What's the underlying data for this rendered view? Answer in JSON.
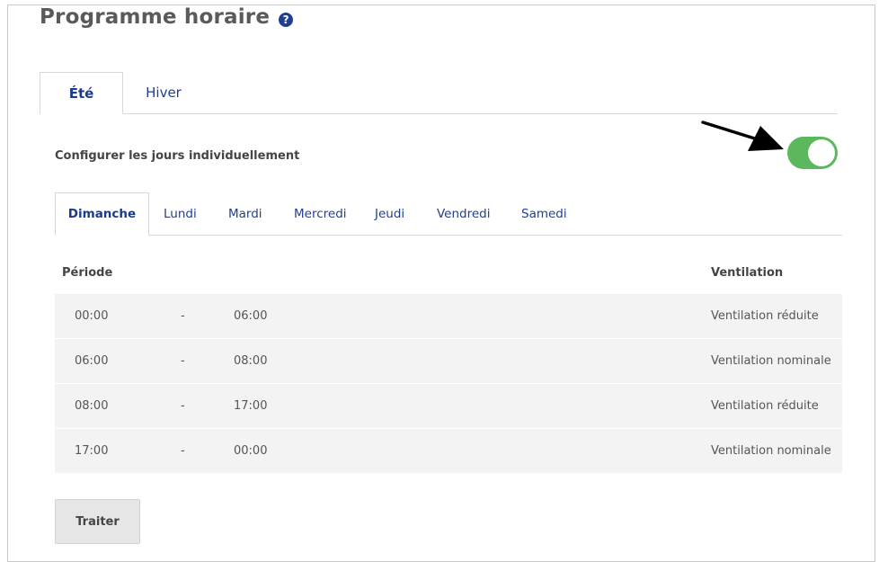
{
  "page": {
    "title": "Programme horaire",
    "help_glyph": "?"
  },
  "season_tabs": [
    {
      "label": "Été",
      "active": true
    },
    {
      "label": "Hiver",
      "active": false
    }
  ],
  "config": {
    "label": "Configurer les jours individuellement",
    "toggle_on": true
  },
  "day_tabs": [
    {
      "label": "Dimanche",
      "active": true
    },
    {
      "label": "Lundi",
      "active": false
    },
    {
      "label": "Mardi",
      "active": false
    },
    {
      "label": "Mercredi",
      "active": false
    },
    {
      "label": "Jeudi",
      "active": false
    },
    {
      "label": "Vendredi",
      "active": false
    },
    {
      "label": "Samedi",
      "active": false
    }
  ],
  "table": {
    "headers": {
      "period": "Période",
      "ventilation": "Ventilation"
    },
    "rows": [
      {
        "start": "00:00",
        "sep": "-",
        "end": "06:00",
        "ventilation": "Ventilation réduite"
      },
      {
        "start": "06:00",
        "sep": "-",
        "end": "08:00",
        "ventilation": "Ventilation nominale"
      },
      {
        "start": "08:00",
        "sep": "-",
        "end": "17:00",
        "ventilation": "Ventilation réduite"
      },
      {
        "start": "17:00",
        "sep": "-",
        "end": "00:00",
        "ventilation": "Ventilation nominale"
      }
    ]
  },
  "actions": {
    "process_label": "Traiter"
  },
  "colors": {
    "accent": "#1f3f94",
    "toggle_on": "#5cb85c",
    "row_bg": "#f3f3f3",
    "button_bg": "#e6e6e6"
  }
}
